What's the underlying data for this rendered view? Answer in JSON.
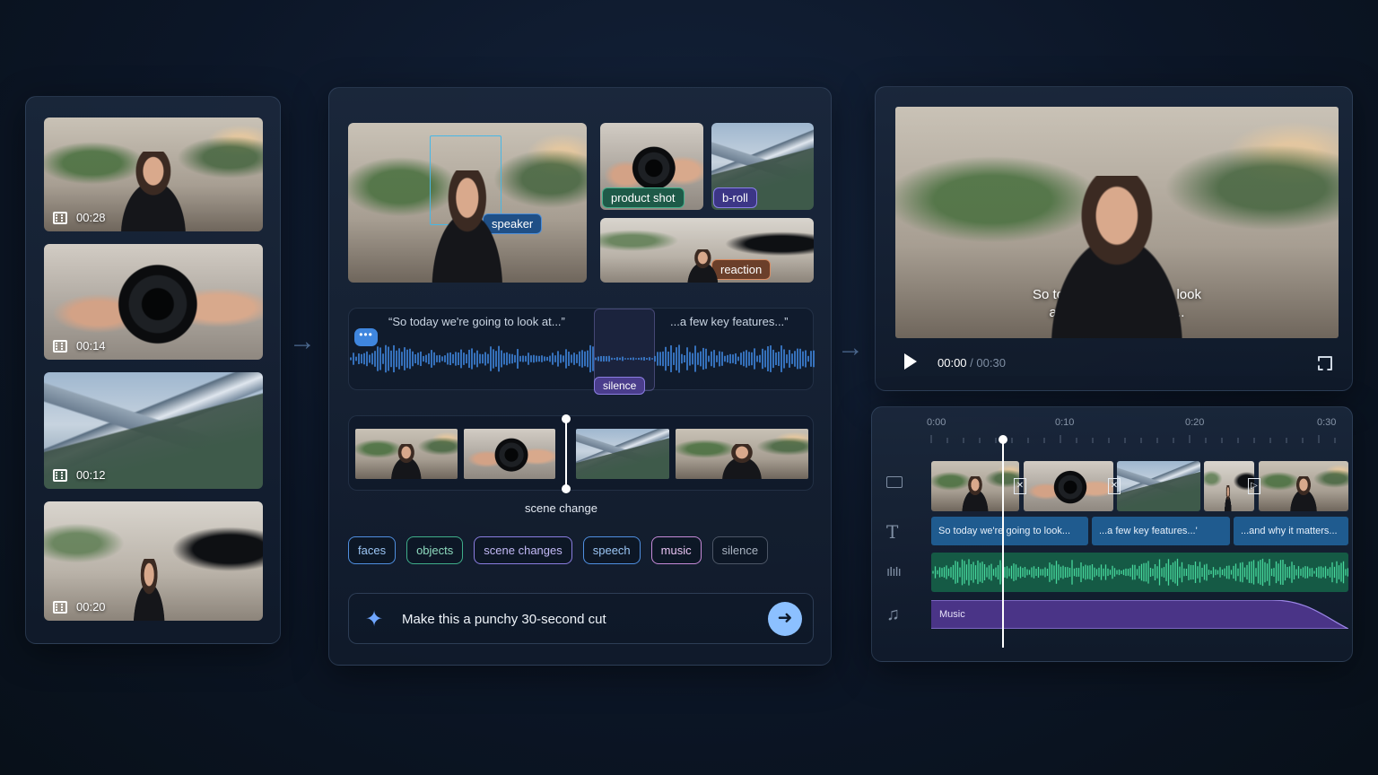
{
  "media_library": {
    "clips": [
      {
        "duration": "00:28",
        "scene": "speaker"
      },
      {
        "duration": "00:14",
        "scene": "camera"
      },
      {
        "duration": "00:12",
        "scene": "mountains"
      },
      {
        "duration": "00:20",
        "scene": "studio"
      }
    ]
  },
  "analysis": {
    "tags": {
      "speaker": "speaker",
      "product_shot": "product shot",
      "b_roll": "b-roll",
      "reaction": "reaction"
    },
    "transcript": {
      "quote1": "“So today we're going to look at...”",
      "quote2": "...a few key features...”",
      "silence": "silence"
    },
    "scene_change_label": "scene change",
    "chips": [
      {
        "label": "faces",
        "color": "#4f8fe0"
      },
      {
        "label": "objects",
        "color": "#3fae8a"
      },
      {
        "label": "scene changes",
        "color": "#8a7de0"
      },
      {
        "label": "speech",
        "color": "#4f8fe0"
      },
      {
        "label": "music",
        "color": "#c68ad8"
      },
      {
        "label": "silence",
        "color": "#6e7a8c"
      }
    ],
    "prompt": "Make this a punchy 30-second cut"
  },
  "preview": {
    "caption_line1": "So today we're going to look",
    "caption_line2": "at a few key features...",
    "time_current": "00:00",
    "time_separator": "/",
    "time_total": "00:30"
  },
  "timeline": {
    "ruler": [
      "0:00",
      "0:10",
      "0:20",
      "0:30"
    ],
    "playhead_fraction": 0.17,
    "captions": [
      "So today we're going to look...",
      "...a few key features...'",
      "...and why it matters..."
    ],
    "music_label": "Music"
  },
  "colors": {
    "accent_blue": "#3f86de",
    "green_wave": "#3fc58f",
    "music_purple": "#5b3f9a"
  }
}
